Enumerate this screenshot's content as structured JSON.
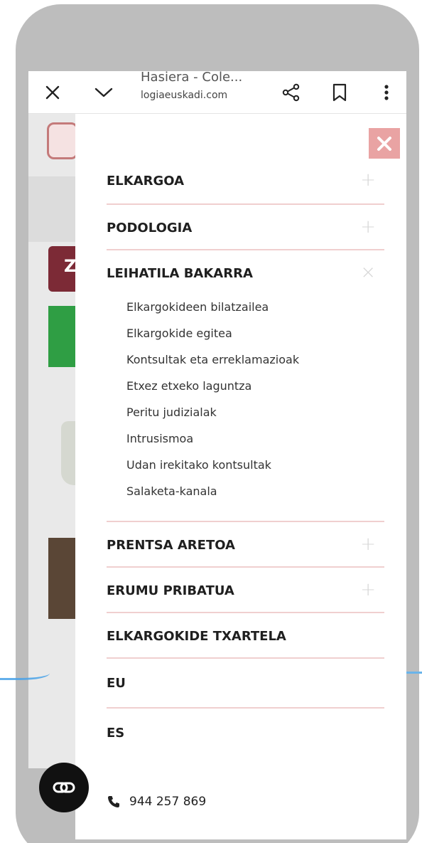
{
  "browser": {
    "title": "Hasiera - Cole...",
    "url": "logiaeuskadi.com"
  },
  "site": {
    "red_badge": "Z"
  },
  "menu": {
    "items": [
      {
        "label": "ELKARGOA",
        "toggle": "+"
      },
      {
        "label": "PODOLOGIA",
        "toggle": "+"
      },
      {
        "label": "LEIHATILA BAKARRA",
        "toggle": "×"
      },
      {
        "label": "PRENTSA ARETOA",
        "toggle": "+"
      },
      {
        "label": "ERUMU PRIBATUA",
        "toggle": "+"
      },
      {
        "label": "ELKARGOKIDE TXARTELA"
      },
      {
        "label": "EU"
      },
      {
        "label": "ES"
      }
    ],
    "submenu": [
      "Elkargokideen bilatzailea",
      "Elkargokide egitea",
      "Kontsultak eta erreklamazioak",
      "Etxez etxeko laguntza",
      "Peritu judizialak",
      "Intrusismoa",
      "Udan irekitako kontsultak",
      "Salaketa-kanala"
    ],
    "phone": "944 257 869"
  },
  "colors": {
    "accent_close": "#e9a3a3",
    "divider": "#f0cfcf",
    "bezel": "#bdbdbd"
  },
  "icons": {
    "close": "close-icon",
    "chevron": "chevron-down-icon",
    "share": "share-icon",
    "bookmark": "bookmark-icon",
    "more": "more-vert-icon",
    "phone": "phone-icon",
    "float": "link-icon"
  }
}
